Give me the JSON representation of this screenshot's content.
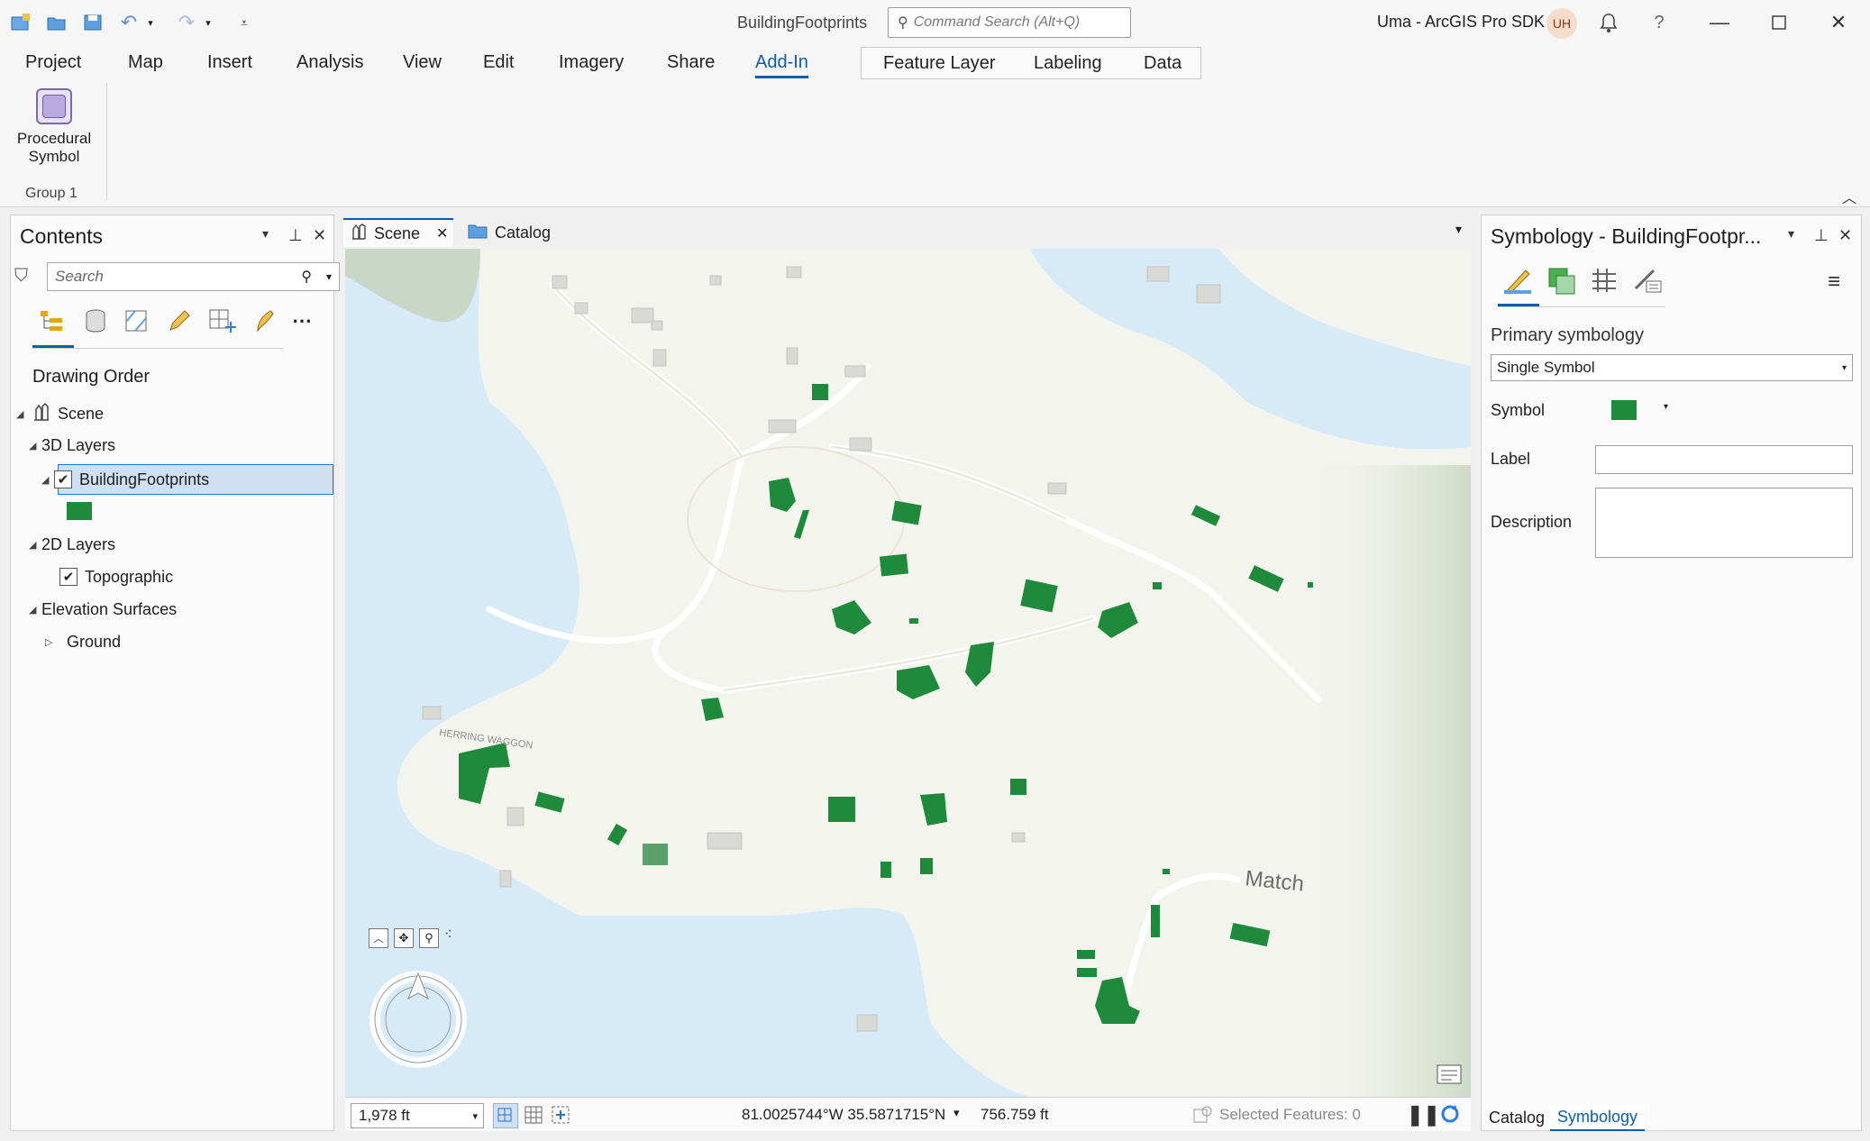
{
  "titlebar": {
    "document_title": "BuildingFootprints",
    "command_search_placeholder": "Command Search (Alt+Q)",
    "user_name": "Uma - ArcGIS Pro SDK",
    "user_initials": "UH",
    "help_glyph": "?"
  },
  "ribbon": {
    "tabs": [
      "Project",
      "Map",
      "Insert",
      "Analysis",
      "View",
      "Edit",
      "Imagery",
      "Share",
      "Add-In"
    ],
    "active_tab": "Add-In",
    "contextual_tabs": [
      "Feature Layer",
      "Labeling",
      "Data"
    ],
    "procedural_symbol_label_line1": "Procedural",
    "procedural_symbol_label_line2": "Symbol",
    "group_label": "Group 1"
  },
  "contents": {
    "title": "Contents",
    "search_placeholder": "Search",
    "section_title": "Drawing Order",
    "tree": {
      "scene": "Scene",
      "layers_3d": "3D Layers",
      "building_footprints": "BuildingFootprints",
      "layers_2d": "2D Layers",
      "topographic": "Topographic",
      "elevation_surfaces": "Elevation Surfaces",
      "ground": "Ground"
    }
  },
  "view": {
    "tabs": [
      "Scene",
      "Catalog"
    ],
    "active_tab": "Scene",
    "map_labels": {
      "road_label": "HERRING WAGGON",
      "place_label": "Match"
    },
    "status": {
      "scale": "1,978 ft",
      "coordinates": "81.0025744°W 35.5871715°N",
      "elevation": "756.759 ft",
      "selected_features": "Selected Features: 0"
    }
  },
  "symbology": {
    "title": "Symbology - BuildingFootpr...",
    "primary_label": "Primary symbology",
    "renderer": "Single Symbol",
    "symbol_label": "Symbol",
    "label_label": "Label",
    "description_label": "Description",
    "bottom_tabs": [
      "Catalog",
      "Symbology"
    ],
    "active_bottom_tab": "Symbology"
  },
  "colors": {
    "accent": "#0b5cad",
    "footprint_green": "#1f8a3b",
    "water": "#d7eaf8",
    "land": "#f4f4ef"
  }
}
